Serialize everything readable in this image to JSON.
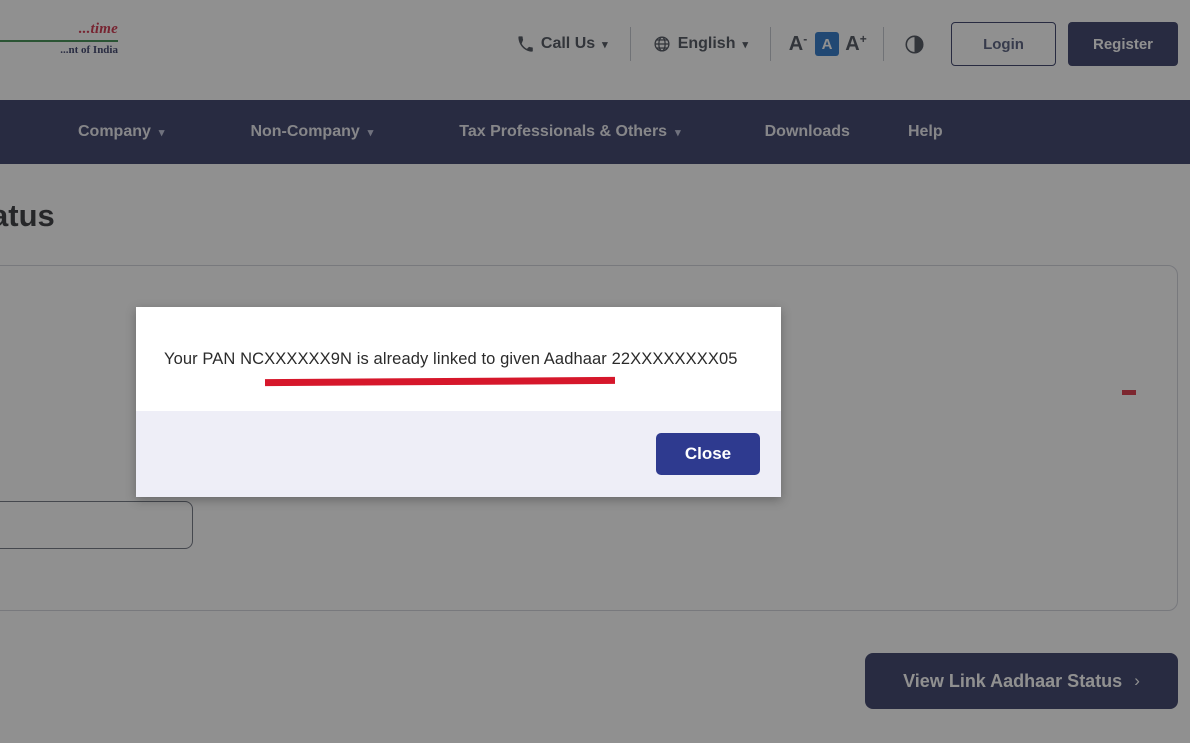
{
  "brand": {
    "line1": "...time",
    "line2": "...nt of India",
    "color_red": "#c8102e",
    "color_rule": "#1f7a34",
    "color_navy": "#1a2150"
  },
  "utility_bar": {
    "call_us": "Call Us",
    "language": "English",
    "font_decrease": "A",
    "font_decrease_sup": "-",
    "font_normal": "A",
    "font_increase": "A",
    "font_increase_sup": "+",
    "login": "Login",
    "register": "Register"
  },
  "nav": {
    "items": [
      {
        "label": "Company",
        "has_caret": true
      },
      {
        "label": "Non-Company",
        "has_caret": true
      },
      {
        "label": "Tax Professionals & Others",
        "has_caret": true
      },
      {
        "label": "Downloads",
        "has_caret": false
      },
      {
        "label": "Help",
        "has_caret": false
      }
    ],
    "background": "#1a2150"
  },
  "main": {
    "page_title": "Status",
    "primary_button": "View Link Aadhaar Status",
    "primary_button_chevron": "›"
  },
  "modal": {
    "message": "Your PAN NCXXXXXX9N is already linked to given Aadhaar 22XXXXXXXX05",
    "close_label": "Close",
    "close_color": "#2e3a8f",
    "footer_color": "#eeeef7",
    "annotation_color": "#d6172b"
  },
  "annotation": {
    "dash_color": "#d6172b"
  }
}
